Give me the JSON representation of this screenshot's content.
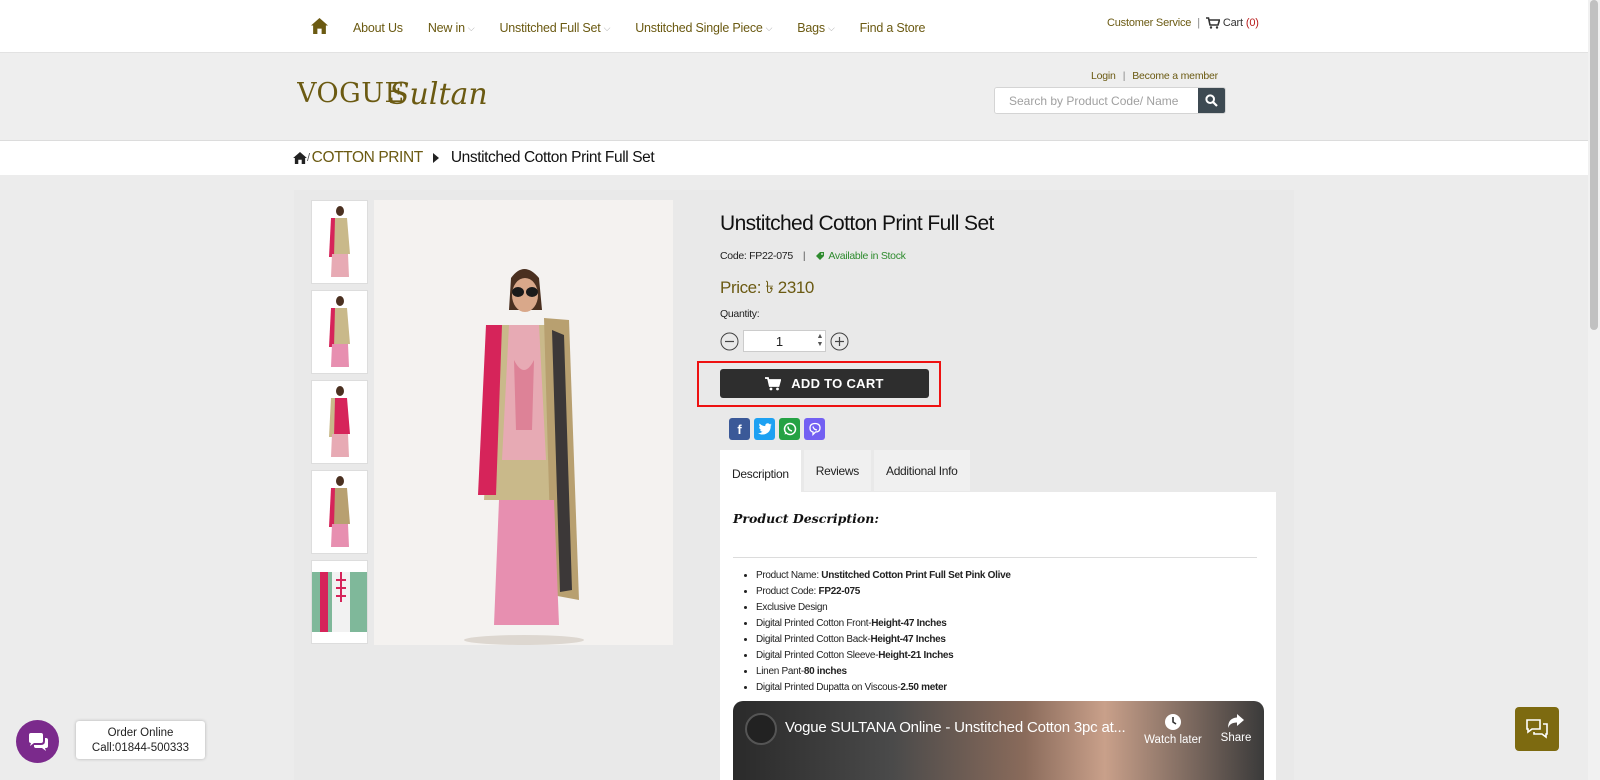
{
  "nav": {
    "home_icon": "home-icon",
    "items": [
      {
        "label": "About Us",
        "has_dropdown": false
      },
      {
        "label": "New in",
        "has_dropdown": true
      },
      {
        "label": "Unstitched Full Set",
        "has_dropdown": true
      },
      {
        "label": "Unstitched Single Piece",
        "has_dropdown": true
      },
      {
        "label": "Bags",
        "has_dropdown": true
      },
      {
        "label": "Find a Store",
        "has_dropdown": false
      }
    ],
    "customer_service": "Customer Service",
    "separator": "|",
    "cart_label": "Cart",
    "cart_count": "(0)"
  },
  "header": {
    "logo_text_1": "VOGUE",
    "logo_text_2": "Sultana",
    "login": "Login",
    "become_member": "Become a member",
    "search_placeholder": "Search by Product Code/ Name"
  },
  "breadcrumb": {
    "category": "COTTON PRINT",
    "current": "Unstitched Cotton Print Full Set"
  },
  "product": {
    "title": "Unstitched Cotton Print Full Set",
    "code_label": "Code:",
    "code": "FP22-075",
    "stock": "Available in Stock",
    "price": "Price: ৳ 2310",
    "quantity_label": "Quantity:",
    "quantity": "1",
    "add_to_cart": "ADD TO CART",
    "thumbnail_count": 5
  },
  "share": [
    "facebook",
    "twitter",
    "whatsapp",
    "viber"
  ],
  "tabs": [
    {
      "label": "Description",
      "active": true
    },
    {
      "label": "Reviews",
      "active": false
    },
    {
      "label": "Additional Info",
      "active": false
    }
  ],
  "description": {
    "heading": "Product Description:",
    "items": [
      {
        "text": "Product Name: ",
        "bold": "Unstitched Cotton Print Full Set Pink Olive"
      },
      {
        "text": "Product Code: ",
        "bold": "FP22-075"
      },
      {
        "text": "Exclusive Design",
        "bold": ""
      },
      {
        "text": "Digital Printed Cotton Front-",
        "bold": "Height-47 Inches"
      },
      {
        "text": "Digital Printed Cotton Back-",
        "bold": "Height-47 Inches"
      },
      {
        "text": "Digital Printed Cotton Sleeve-",
        "bold": "Height-21 Inches"
      },
      {
        "text": "Linen Pant-",
        "bold": "80 inches"
      },
      {
        "text": "Digital Printed Dupatta on Viscous-",
        "bold": "2.50 meter"
      }
    ]
  },
  "video": {
    "title": "Vogue SULTANA Online - Unstitched Cotton 3pc at...",
    "watch_later": "Watch later",
    "share": "Share"
  },
  "chat": {
    "line1": "Order Online",
    "line2": "Call:01844-500333"
  },
  "colors": {
    "brand_gold": "#6b5a12",
    "button_dark": "#2e2e2e",
    "highlight_red": "#e11111",
    "stock_green": "#2e8b2e",
    "chat_purple": "#7b2a8c"
  }
}
